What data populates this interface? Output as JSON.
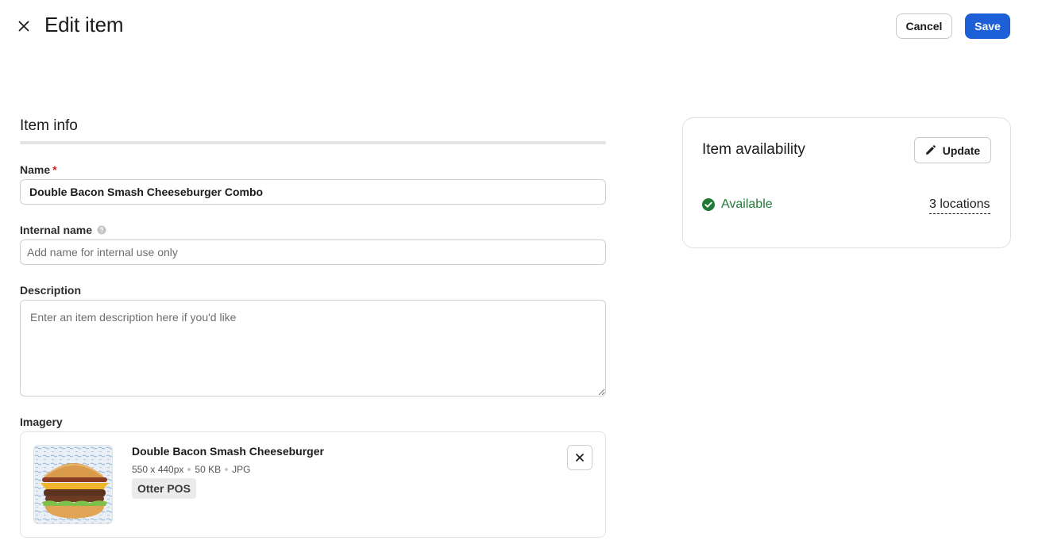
{
  "header": {
    "title": "Edit item",
    "cancel_label": "Cancel",
    "save_label": "Save"
  },
  "item_info": {
    "section_title": "Item info",
    "name": {
      "label": "Name",
      "required_marker": "*",
      "value": "Double Bacon Smash Cheeseburger Combo"
    },
    "internal_name": {
      "label": "Internal name",
      "placeholder": "Add name for internal use only",
      "value": ""
    },
    "description": {
      "label": "Description",
      "placeholder": "Enter an item description here if you'd like",
      "value": ""
    },
    "imagery": {
      "label": "Imagery",
      "image": {
        "name": "Double Bacon Smash Cheeseburger",
        "dimensions": "550 x 440px",
        "size": "50 KB",
        "format": "JPG",
        "source_tag": "Otter POS"
      }
    }
  },
  "availability": {
    "title": "Item availability",
    "update_label": "Update",
    "status": "Available",
    "locations_label": "3 locations"
  },
  "colors": {
    "primary": "#1d5fd6",
    "available_green": "#1f7a35",
    "required_red": "#d0211c"
  },
  "icons": {
    "close": "close-icon",
    "help": "help-icon",
    "remove": "close-icon",
    "edit": "pencil-icon",
    "status": "check-circle-icon"
  }
}
